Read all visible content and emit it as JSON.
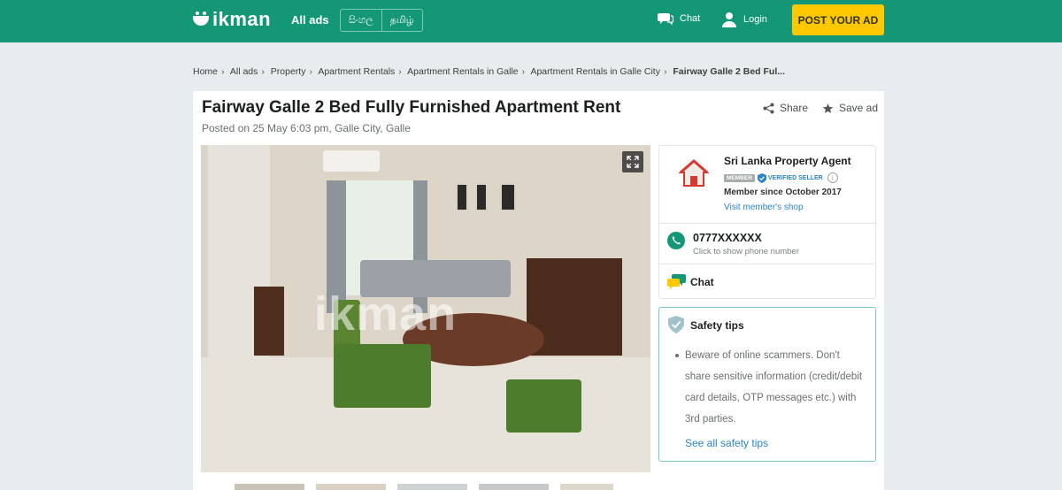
{
  "header": {
    "logo_text": "ikman",
    "all_ads": "All ads",
    "langs": [
      "සිංහල",
      "தமிழ்"
    ],
    "chat": "Chat",
    "login": "Login",
    "post_ad": "POST YOUR AD"
  },
  "breadcrumb": [
    "Home",
    "All ads",
    "Property",
    "Apartment Rentals",
    "Apartment Rentals in Galle",
    "Apartment Rentals in Galle City",
    "Fairway Galle 2 Bed Ful..."
  ],
  "ad": {
    "title": "Fairway Galle 2 Bed Fully Furnished Apartment Rent",
    "posted": "Posted on 25 May 6:03 pm, Galle City, Galle",
    "share": "Share",
    "save": "Save ad",
    "watermark": "ikman"
  },
  "seller": {
    "name": "Sri Lanka Property Agent",
    "member_badge": "MEMBER",
    "verified": "VERIFIED SELLER",
    "info_icon": "i",
    "since": "Member since October 2017",
    "visit": "Visit member's shop",
    "phone": "0777XXXXXX",
    "phone_hint": "Click to show phone number",
    "chat": "Chat"
  },
  "safety": {
    "title": "Safety tips",
    "tip": "Beware of online scammers. Don't share sensitive information (credit/debit card details, OTP messages etc.) with 3rd parties.",
    "see_all": "See all safety tips"
  },
  "colors": {
    "brand_green": "#149777",
    "post_yellow": "#ffc800",
    "link_blue": "#2b85c8",
    "safety_border": "#7cc6d1"
  },
  "icons": [
    "chat-icon",
    "user-icon",
    "share-icon",
    "star-icon",
    "expand-icon",
    "house-icon",
    "verified-icon",
    "phone-icon",
    "chat-bubble-icon",
    "shield-icon"
  ]
}
